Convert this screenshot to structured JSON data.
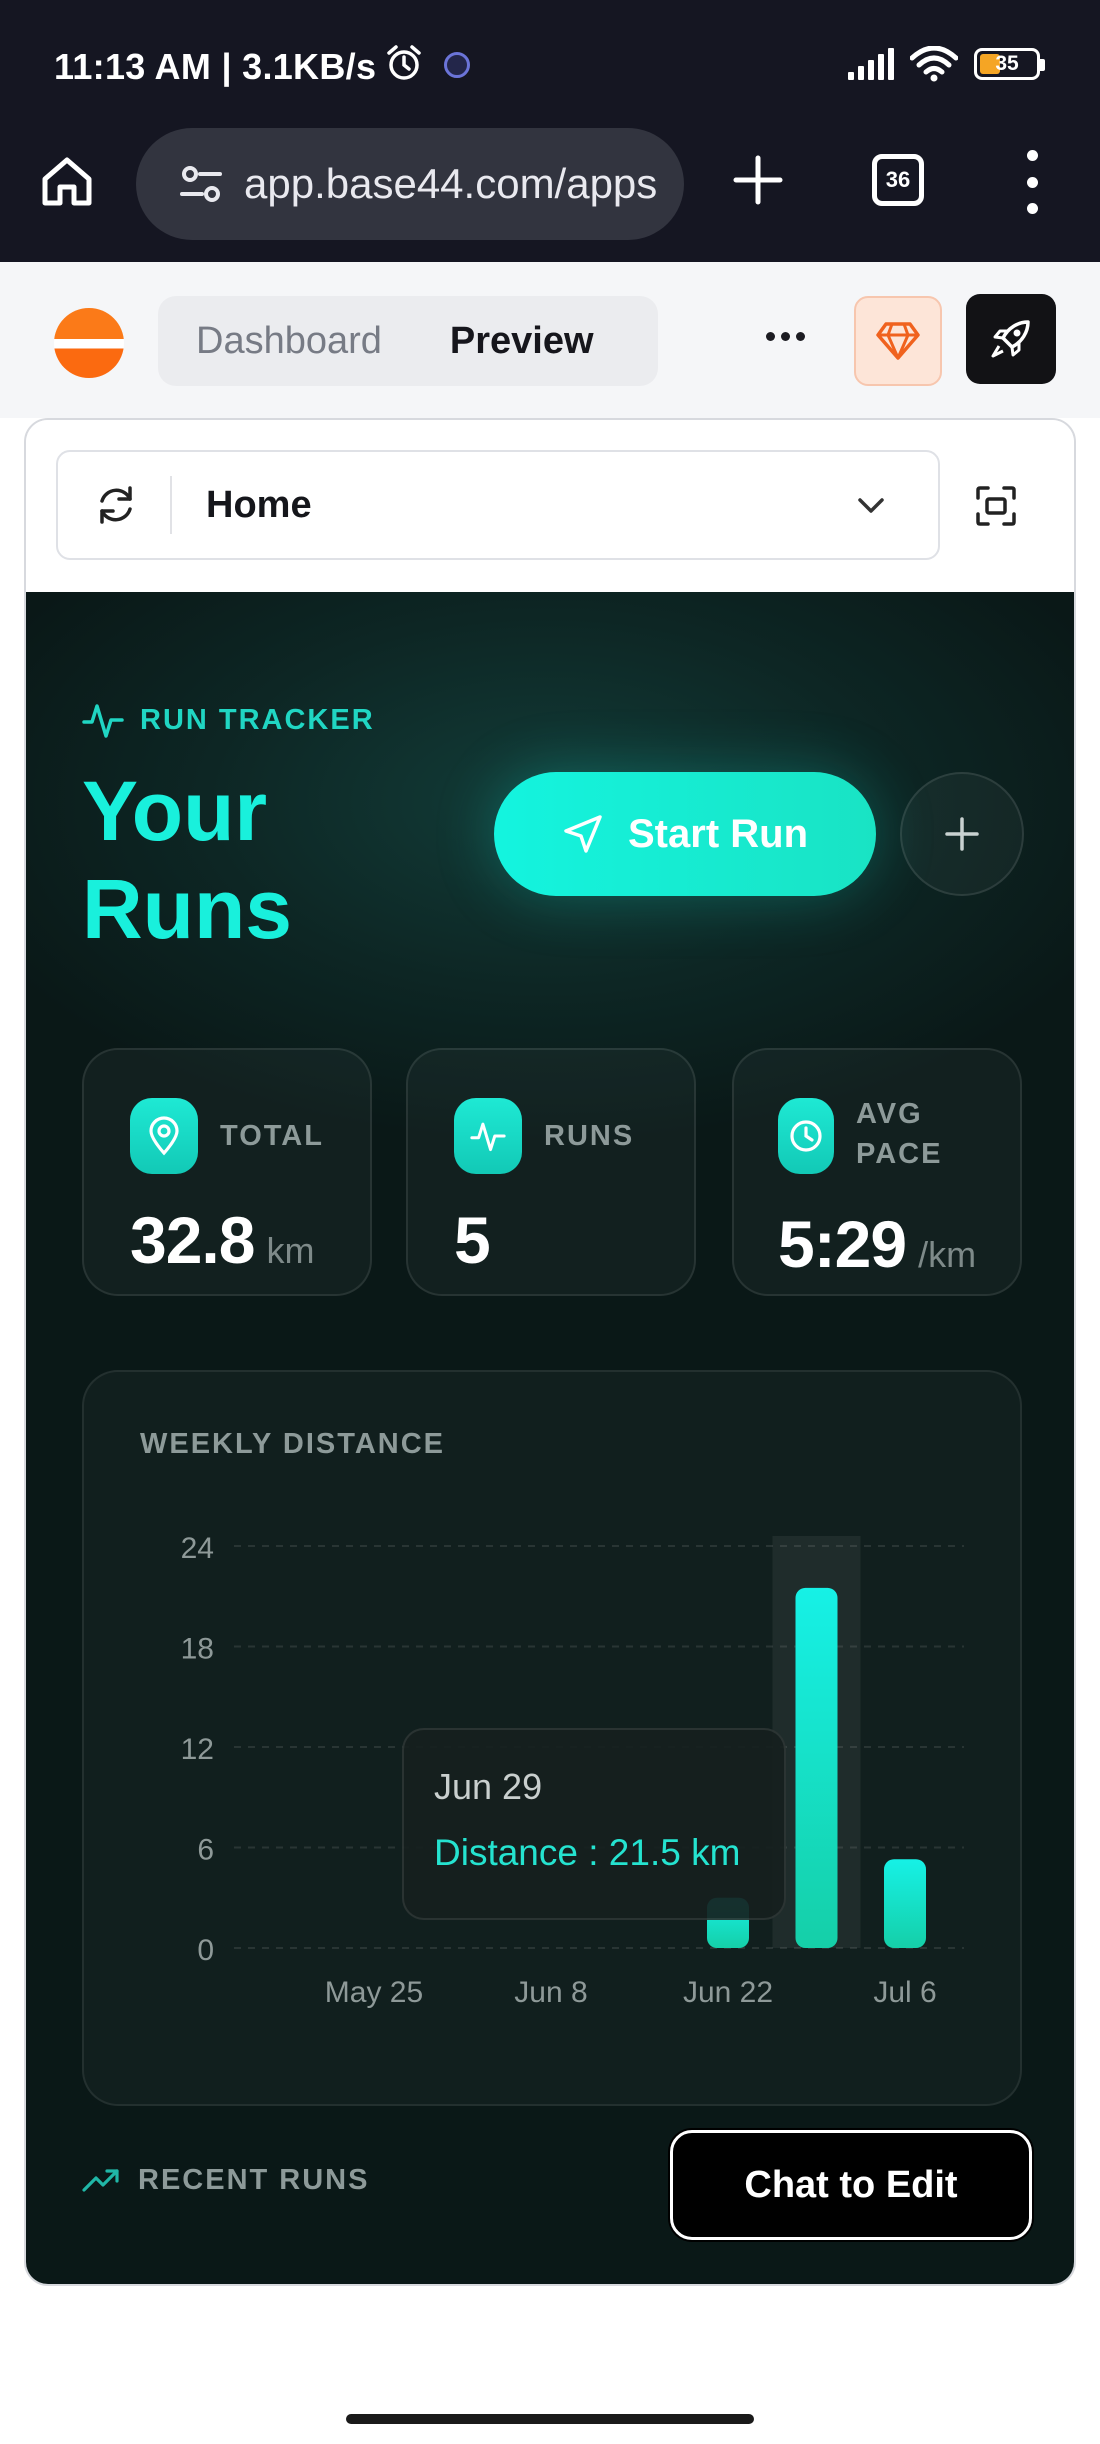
{
  "status_bar": {
    "time": "11:13 AM | 3.1KB/s",
    "battery": "35",
    "icons": [
      "alarm-icon",
      "app-notification-icon",
      "signal-icon",
      "wifi-icon",
      "battery-icon"
    ]
  },
  "browser": {
    "url": "app.base44.com/apps",
    "tab_count": "36",
    "icons": [
      "home-icon",
      "site-settings-icon",
      "new-tab-icon",
      "menu-icon"
    ]
  },
  "app_header": {
    "tabs": [
      {
        "label": "Dashboard",
        "active": false
      },
      {
        "label": "Preview",
        "active": true
      }
    ],
    "accent": "#fb6a10",
    "icons": [
      "base44-logo",
      "more-icon",
      "gem-icon",
      "rocket-icon"
    ]
  },
  "preview": {
    "route": "Home",
    "icons": [
      "refresh-icon",
      "chevron-down-icon",
      "fullscreen-icon"
    ]
  },
  "app": {
    "kicker": "RUN TRACKER",
    "title": "Your Runs",
    "start_button": "Start Run",
    "accent": "#19f0dc",
    "background": "#0d2624",
    "stats": {
      "total": {
        "label": "TOTAL",
        "value": "32.8",
        "unit": "km",
        "icon": "location-pin-icon"
      },
      "runs": {
        "label": "RUNS",
        "value": "5",
        "unit": "",
        "icon": "activity-icon"
      },
      "pace": {
        "label": "AVG PACE",
        "value": "5:29",
        "unit": "/km",
        "icon": "clock-icon"
      }
    },
    "recent_label": "RECENT RUNS"
  },
  "chart_data": {
    "type": "bar",
    "title": "WEEKLY DISTANCE",
    "x_tick_labels": [
      "May 25",
      "Jun 8",
      "Jun 22",
      "Jul 6"
    ],
    "y_ticks": [
      0,
      6,
      12,
      18,
      24
    ],
    "ylim": [
      0,
      24
    ],
    "grid": true,
    "bars": [
      {
        "week": "Jun 22",
        "value": 3.0
      },
      {
        "week": "Jun 29",
        "value": 21.5
      },
      {
        "week": "Jul 6",
        "value": 5.3
      }
    ],
    "highlighted": "Jun 29",
    "tooltip": {
      "date": "Jun 29",
      "label": "Distance : 21.5 km"
    }
  },
  "chat_button": "Chat to Edit"
}
